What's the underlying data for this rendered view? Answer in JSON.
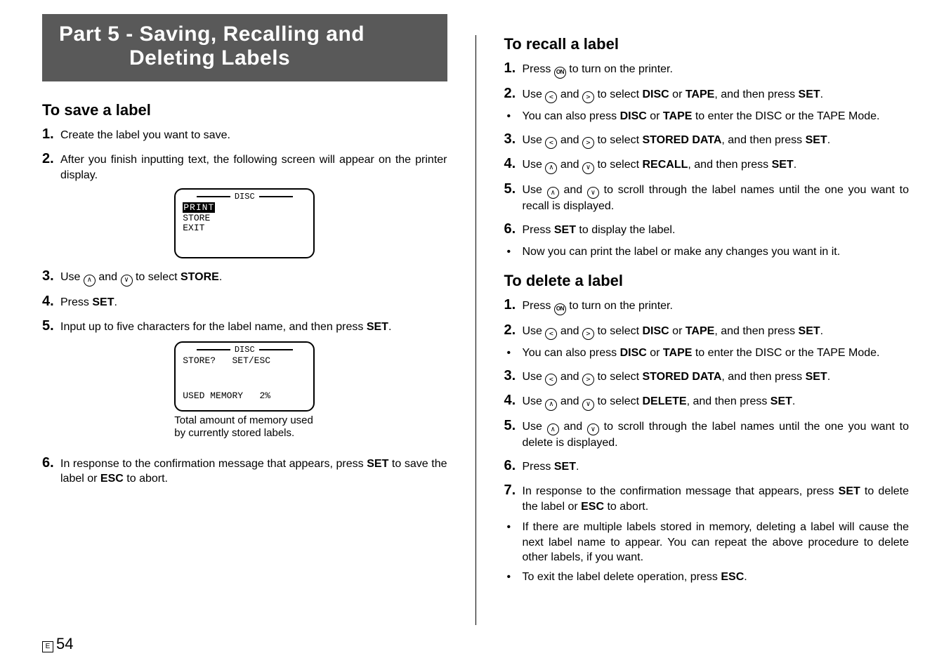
{
  "title_line1": "Part 5 - Saving, Recalling and",
  "title_line2": "Deleting Labels",
  "page_number": "54",
  "page_marker": "E",
  "save": {
    "heading": "To save a label",
    "s1": "Create the label you want to save.",
    "s2": "After you finish inputting text, the following screen will appear on the printer display.",
    "lcd1_header": "DISC",
    "lcd1_line1": "PRINT",
    "lcd1_line2": "STORE",
    "lcd1_line3": "EXIT",
    "s3_a": "Use ",
    "s3_b": " and ",
    "s3_c": " to select ",
    "s3_store": "STORE",
    "s4_a": "Press ",
    "s4_set": "SET",
    "s5_a": "Input up to five characters for the label name, and then press ",
    "s5_set": "SET",
    "lcd2_header": "DISC",
    "lcd2_line1": "STORE?   SET/ESC",
    "lcd2_line2": "USED MEMORY   2%",
    "lcd2_note": "Total amount of memory used by currently stored labels.",
    "s6_a": "In response to the confirmation message that appears, press ",
    "s6_set": "SET",
    "s6_b": " to save the label or ",
    "s6_esc": "ESC",
    "s6_c": " to abort."
  },
  "recall": {
    "heading": "To recall a label",
    "s1_a": "Press ",
    "s1_b": " to turn on the printer.",
    "s2_a": "Use ",
    "s2_b": " and ",
    "s2_c": " to select ",
    "s2_disc": "DISC",
    "s2_or": " or ",
    "s2_tape": "TAPE",
    "s2_d": ", and then press ",
    "s2_set": "SET",
    "b1_a": "You can also press ",
    "b1_disc": "DISC",
    "b1_or": " or ",
    "b1_tape": "TAPE",
    "b1_b": " to enter the DISC or the TAPE Mode.",
    "s3_a": "Use ",
    "s3_b": " and ",
    "s3_c": " to select ",
    "s3_sd": "STORED DATA",
    "s3_d": ", and then press ",
    "s3_set": "SET",
    "s4_a": "Use ",
    "s4_b": " and ",
    "s4_c": " to select ",
    "s4_recall": "RECALL",
    "s4_d": ", and then press ",
    "s4_set": "SET",
    "s5_a": "Use ",
    "s5_b": " and ",
    "s5_c": " to scroll through the label names until the one you want to recall is displayed.",
    "s6_a": "Press ",
    "s6_set": "SET",
    "s6_b": " to display the label.",
    "b2": "Now you can print the label or make any changes you want in it."
  },
  "del": {
    "heading": "To delete a label",
    "s1_a": "Press ",
    "s1_b": " to turn on the printer.",
    "s2_a": "Use ",
    "s2_b": " and ",
    "s2_c": " to select ",
    "s2_disc": "DISC",
    "s2_or": " or ",
    "s2_tape": "TAPE",
    "s2_d": ", and then press ",
    "s2_set": "SET",
    "b1_a": "You can also press ",
    "b1_disc": "DISC",
    "b1_or": " or ",
    "b1_tape": "TAPE",
    "b1_b": " to enter the DISC or the TAPE Mode.",
    "s3_a": "Use ",
    "s3_b": " and ",
    "s3_c": " to select ",
    "s3_sd": "STORED DATA",
    "s3_d": ", and then press ",
    "s3_set": "SET",
    "s4_a": "Use ",
    "s4_b": " and ",
    "s4_c": " to select ",
    "s4_delete": "DELETE",
    "s4_d": ", and then press ",
    "s4_set": "SET",
    "s5_a": "Use ",
    "s5_b": " and ",
    "s5_c": " to scroll through the label names until the one you want to delete is displayed.",
    "s6_a": "Press ",
    "s6_set": "SET",
    "s7_a": "In response to the confirmation message that appears, press ",
    "s7_set": "SET",
    "s7_b": " to delete the label or ",
    "s7_esc": "ESC",
    "s7_c": " to abort.",
    "b2": "If there are multiple labels stored in memory, deleting a label will cause the next label name to appear. You can repeat the above procedure to delete other labels, if you want.",
    "b3_a": "To exit the label delete operation, press ",
    "b3_esc": "ESC",
    "b3_b": "."
  }
}
